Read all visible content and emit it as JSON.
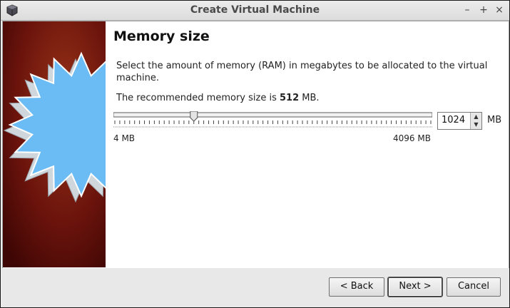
{
  "window": {
    "title": "Create Virtual Machine",
    "buttons": {
      "minimize": "–",
      "maximize": "+",
      "close": "×"
    }
  },
  "page": {
    "heading": "Memory size",
    "description": "Select the amount of memory (RAM) in megabytes to be allocated to the virtual machine.",
    "recommend_prefix": "The recommended memory size is ",
    "recommend_value": "512",
    "recommend_suffix": " MB."
  },
  "memory": {
    "value": "1024",
    "unit": "MB",
    "min_label": "4 MB",
    "max_label": "4096 MB",
    "level": 0.25
  },
  "buttons": {
    "back": "< Back",
    "next": "Next >",
    "cancel": "Cancel"
  },
  "colors": {
    "panel_dark": "#5a0e0a",
    "panel_light": "#8a2a14",
    "star": "#6bbcf5"
  },
  "icons": {
    "app": "virtualbox-icon",
    "decor": "starburst-graphic"
  }
}
